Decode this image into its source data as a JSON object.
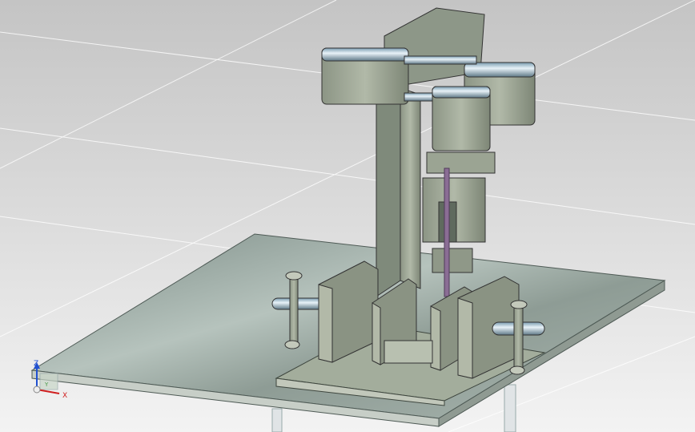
{
  "viewport": {
    "background_top": "#c8c8c8",
    "background_bottom": "#f2f2f2",
    "model_color": "#9aa394",
    "model_dark": "#6f7a70",
    "probe_color": "#8a6d94"
  },
  "triad": {
    "x_label": "X",
    "y_label": "Y",
    "z_label": "Z",
    "x_color": "#d02020",
    "y_color": "#4a9a4a",
    "z_color": "#2050d0"
  }
}
